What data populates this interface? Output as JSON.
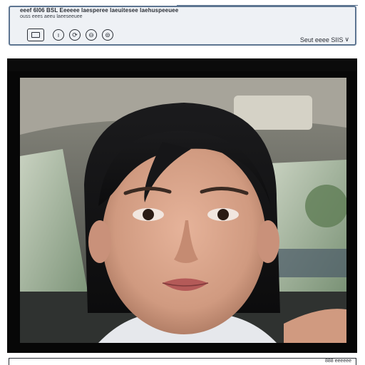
{
  "toolbar": {
    "title": "eeef 6I06 BSL Eeeeee laesperee laeuitesee laehuspeeuee",
    "subtitle": "ouss eees aeeu laeeseeuee",
    "buttons": [
      {
        "icon": "frame-icon",
        "glyph": ""
      },
      {
        "icon": "info-icon",
        "glyph": "ı"
      },
      {
        "icon": "rotate-icon",
        "glyph": "⟳"
      },
      {
        "icon": "record-icon",
        "glyph": "⊖"
      },
      {
        "icon": "settings-icon",
        "glyph": "⊜"
      }
    ],
    "sort_label": "Seut eeee SIIS",
    "sort_chevron": "∨"
  },
  "photo": {
    "description_icon": "portrait-image"
  },
  "status": {
    "text": "888 eeeeee"
  },
  "colors": {
    "panel_border": "#5d7591",
    "panel_bg": "#eef1f5",
    "frame_bg": "#070707",
    "text": "#2b2f36"
  }
}
